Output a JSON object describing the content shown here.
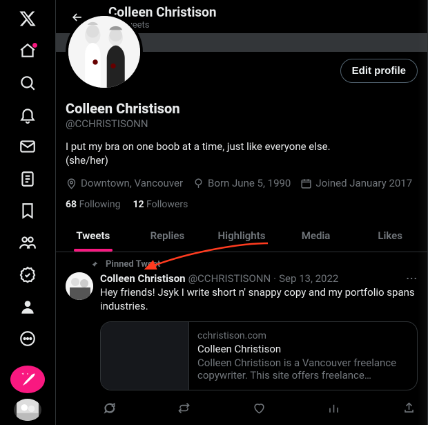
{
  "header": {
    "name": "Colleen Christison",
    "subline": "40 Tweets"
  },
  "profile": {
    "display_name": "Colleen Christison",
    "handle": "@CCHRISTISONN",
    "bio_line1": "I put my bra on one boob at a time, just like everyone else.",
    "bio_line2": "(she/her)",
    "location": "Downtown, Vancouver",
    "birth": "Born June 5, 1990",
    "joined": "Joined January 2017",
    "following_count": "68",
    "following_label": "Following",
    "followers_count": "12",
    "followers_label": "Followers",
    "edit_label": "Edit profile"
  },
  "tabs": {
    "tweets": "Tweets",
    "replies": "Replies",
    "highlights": "Highlights",
    "media": "Media",
    "likes": "Likes"
  },
  "pinned_label": "Pinned Tweet",
  "tweet": {
    "author_name": "Colleen Christison",
    "author_handle": "@CCHRISTISONN",
    "separator": "·",
    "date": "Sep 13, 2022",
    "text": "Hey friends! Jsyk I write short n' snappy copy and my portfolio spans industries.",
    "card": {
      "domain": "cchristison.com",
      "title": "Colleen Christison",
      "description": "Colleen Christison is a Vancouver freelance copywriter. This site offers freelance copywriting …"
    }
  },
  "colors": {
    "accent": "#f91880",
    "text": "#e7e9ea",
    "muted": "#71767b",
    "border": "#2f3336"
  }
}
